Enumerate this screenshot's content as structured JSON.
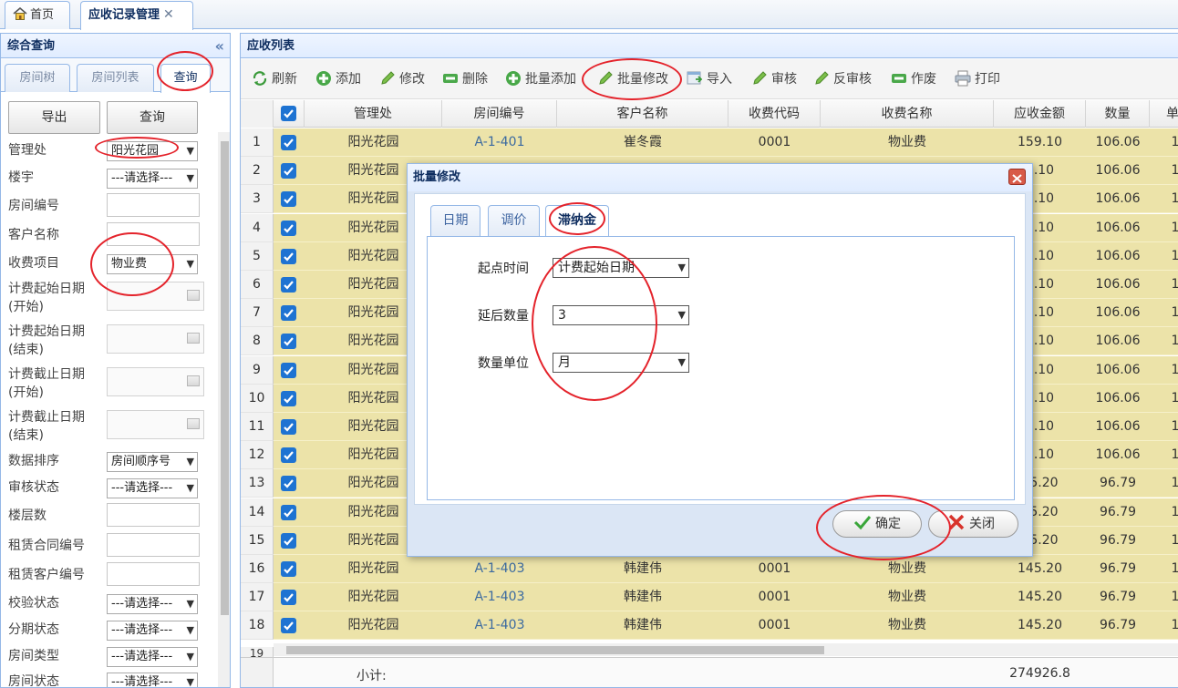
{
  "top_tabs": {
    "home": "首页",
    "active": "应收记录管理",
    "close_glyph": "✕"
  },
  "left_panel": {
    "title": "综合查询",
    "collapse_glyph": "«",
    "tabs": [
      "房间树",
      "房间列表",
      "查询"
    ],
    "export_label": "导出",
    "query_label": "查询",
    "fields": {
      "mgmt": {
        "label": "管理处",
        "value": "阳光花园"
      },
      "building": {
        "label": "楼宇",
        "value": "---请选择---"
      },
      "room_no": {
        "label": "房间编号"
      },
      "customer": {
        "label": "客户名称"
      },
      "fee_item": {
        "label": "收费项目",
        "value": "物业费"
      },
      "start_from_l1": "计费起始日期",
      "start_from_l2": "(开始)",
      "start_to_l1": "计费起始日期",
      "start_to_l2": "(结束)",
      "end_from_l1": "计费截止日期",
      "end_from_l2": "(开始)",
      "end_to_l1": "计费截止日期",
      "end_to_l2": "(结束)",
      "sort": {
        "label": "数据排序",
        "value": "房间顺序号"
      },
      "audit": {
        "label": "审核状态",
        "value": "---请选择---"
      },
      "floors": {
        "label": "楼层数"
      },
      "lease_no": {
        "label": "租赁合同编号"
      },
      "lease_cust": {
        "label": "租赁客户编号"
      },
      "verify": {
        "label": "校验状态",
        "value": "---请选择---"
      },
      "install": {
        "label": "分期状态",
        "value": "---请选择---"
      },
      "room_type": {
        "label": "房间类型",
        "value": "---请选择---"
      },
      "room_state": {
        "label": "房间状态",
        "value": "---请选择---"
      }
    }
  },
  "right_panel": {
    "title": "应收列表",
    "toolbar": {
      "refresh": "刷新",
      "add": "添加",
      "edit": "修改",
      "delete": "删除",
      "batch_add": "批量添加",
      "batch_edit": "批量修改",
      "import": "导入",
      "audit": "审核",
      "unaudit": "反审核",
      "void": "作废",
      "print": "打印"
    },
    "columns": [
      "管理处",
      "房间编号",
      "客户名称",
      "收费代码",
      "收费名称",
      "应收金额",
      "数量",
      "单"
    ],
    "rows": [
      {
        "n": "1",
        "mgmt": "阳光花园",
        "room": "A-1-401",
        "cust": "崔冬霞",
        "code": "0001",
        "name": "物业费",
        "amount": "159.10",
        "qty": "106.06",
        "x": "1"
      },
      {
        "n": "2",
        "mgmt": "阳光花园",
        "room": "",
        "cust": "",
        "code": "",
        "name": "",
        "amount": "9.10",
        "qty": "106.06",
        "x": "1"
      },
      {
        "n": "3",
        "mgmt": "阳光花园",
        "room": "",
        "cust": "",
        "code": "",
        "name": "",
        "amount": "9.10",
        "qty": "106.06",
        "x": "1"
      },
      {
        "n": "4",
        "mgmt": "阳光花园",
        "room": "",
        "cust": "",
        "code": "",
        "name": "",
        "amount": "9.10",
        "qty": "106.06",
        "x": "1"
      },
      {
        "n": "5",
        "mgmt": "阳光花园",
        "room": "",
        "cust": "",
        "code": "",
        "name": "",
        "amount": "9.10",
        "qty": "106.06",
        "x": "1"
      },
      {
        "n": "6",
        "mgmt": "阳光花园",
        "room": "",
        "cust": "",
        "code": "",
        "name": "",
        "amount": "9.10",
        "qty": "106.06",
        "x": "1"
      },
      {
        "n": "7",
        "mgmt": "阳光花园",
        "room": "",
        "cust": "",
        "code": "",
        "name": "",
        "amount": "9.10",
        "qty": "106.06",
        "x": "1"
      },
      {
        "n": "8",
        "mgmt": "阳光花园",
        "room": "",
        "cust": "",
        "code": "",
        "name": "",
        "amount": "9.10",
        "qty": "106.06",
        "x": "1"
      },
      {
        "n": "9",
        "mgmt": "阳光花园",
        "room": "",
        "cust": "",
        "code": "",
        "name": "",
        "amount": "9.10",
        "qty": "106.06",
        "x": "1"
      },
      {
        "n": "10",
        "mgmt": "阳光花园",
        "room": "",
        "cust": "",
        "code": "",
        "name": "",
        "amount": "9.10",
        "qty": "106.06",
        "x": "1"
      },
      {
        "n": "11",
        "mgmt": "阳光花园",
        "room": "",
        "cust": "",
        "code": "",
        "name": "",
        "amount": "9.10",
        "qty": "106.06",
        "x": "1"
      },
      {
        "n": "12",
        "mgmt": "阳光花园",
        "room": "",
        "cust": "",
        "code": "",
        "name": "",
        "amount": "9.10",
        "qty": "106.06",
        "x": "1"
      },
      {
        "n": "13",
        "mgmt": "阳光花园",
        "room": "",
        "cust": "",
        "code": "",
        "name": "",
        "amount": "45.20",
        "qty": "96.79",
        "x": "1"
      },
      {
        "n": "14",
        "mgmt": "阳光花园",
        "room": "",
        "cust": "",
        "code": "",
        "name": "",
        "amount": "45.20",
        "qty": "96.79",
        "x": "1"
      },
      {
        "n": "15",
        "mgmt": "阳光花园",
        "room": "",
        "cust": "",
        "code": "",
        "name": "",
        "amount": "45.20",
        "qty": "96.79",
        "x": "1"
      },
      {
        "n": "16",
        "mgmt": "阳光花园",
        "room": "A-1-403",
        "cust": "韩建伟",
        "code": "0001",
        "name": "物业费",
        "amount": "145.20",
        "qty": "96.79",
        "x": "1"
      },
      {
        "n": "17",
        "mgmt": "阳光花园",
        "room": "A-1-403",
        "cust": "韩建伟",
        "code": "0001",
        "name": "物业费",
        "amount": "145.20",
        "qty": "96.79",
        "x": "1"
      },
      {
        "n": "18",
        "mgmt": "阳光花园",
        "room": "A-1-403",
        "cust": "韩建伟",
        "code": "0001",
        "name": "物业费",
        "amount": "145.20",
        "qty": "96.79",
        "x": "1"
      }
    ],
    "partial_row_no": "19",
    "footer": {
      "label": "小计:",
      "amount": "274926.8"
    }
  },
  "dialog": {
    "title": "批量修改",
    "tabs": [
      "日期",
      "调价",
      "滞纳金"
    ],
    "fields": {
      "start": {
        "label": "起点时间",
        "value": "计费起始日期"
      },
      "delay": {
        "label": "延后数量",
        "value": "3"
      },
      "unit": {
        "label": "数量单位",
        "value": "月"
      }
    },
    "ok_label": "确定",
    "close_label": "关闭"
  },
  "colors": {
    "accent": "#95b8e7",
    "row_highlight": "#ece3a9",
    "checkbox": "#1e73d2",
    "annotation": "#e4232b"
  }
}
